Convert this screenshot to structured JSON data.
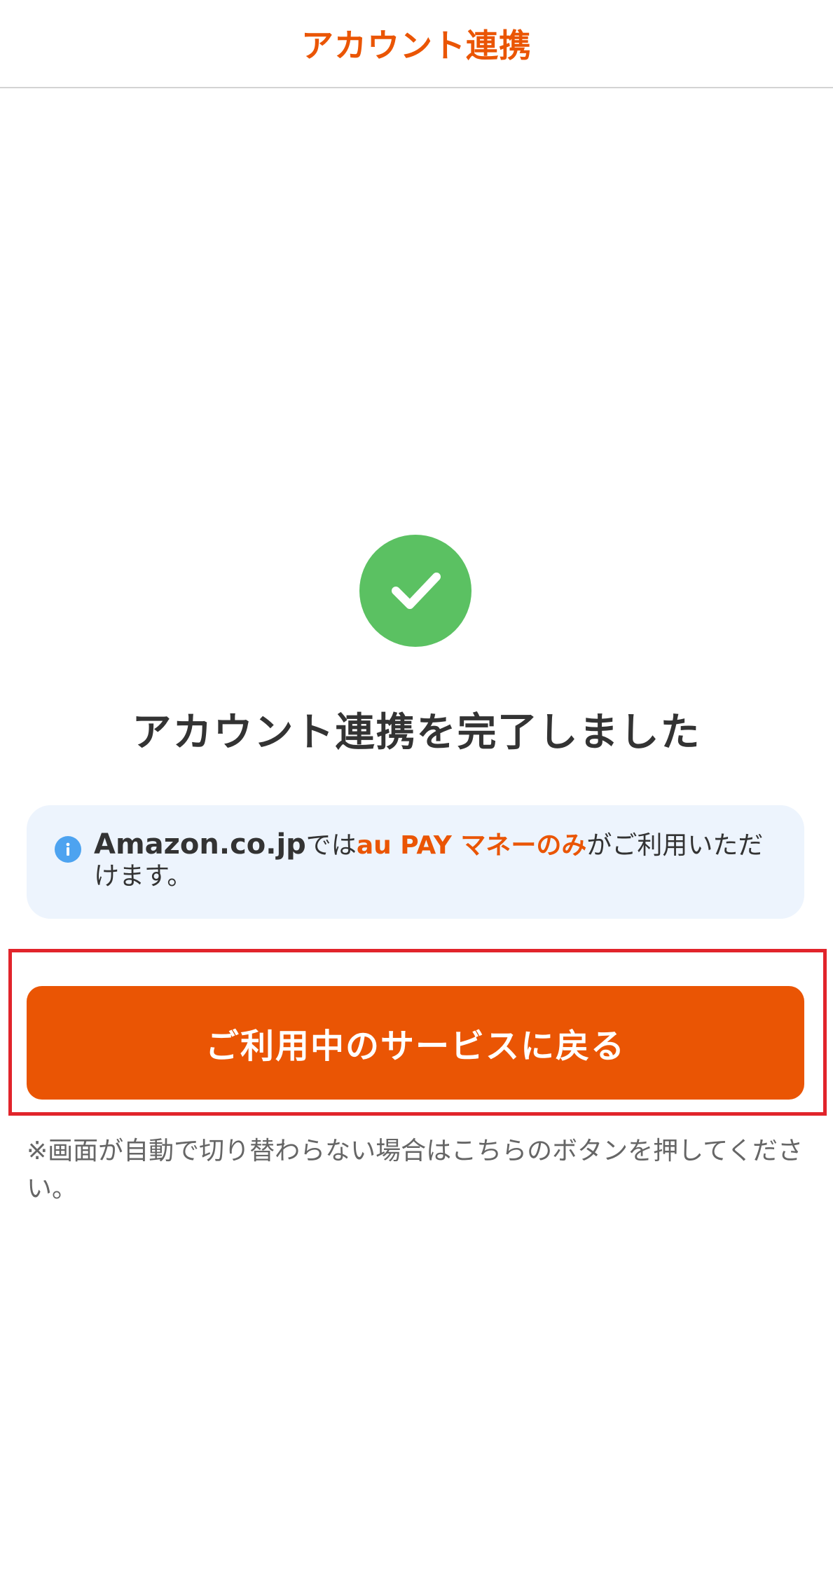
{
  "header": {
    "title": "アカウント連携"
  },
  "status": {
    "icon": "check-circle-icon",
    "title": "アカウント連携を完了しました"
  },
  "info": {
    "icon": "info-icon",
    "brand": "Amazon.co.jp",
    "text_1": "では",
    "highlight": "au PAY マネーのみ",
    "text_2": "がご利用いただけます。"
  },
  "actions": {
    "return_label": "ご利用中のサービスに戻る"
  },
  "note": {
    "text": "※画面が自動で切り替わらない場合はこちらのボタンを押してください。"
  },
  "colors": {
    "accent": "#ea5504",
    "success": "#5bc162",
    "info_bg": "#edf4fd",
    "info_icon": "#4da3f0",
    "highlight_frame": "#e1242b"
  }
}
